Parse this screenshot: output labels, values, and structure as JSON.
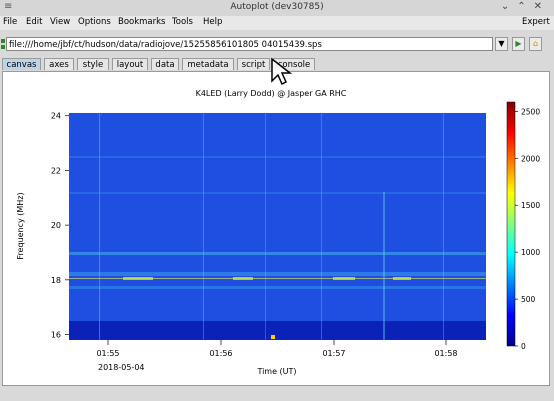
{
  "window": {
    "title": "Autoplot (dev30785)"
  },
  "menu": {
    "file": "File",
    "edit": "Edit",
    "view": "View",
    "options": "Options",
    "bookmarks": "Bookmarks",
    "tools": "Tools",
    "help": "Help",
    "expert": "Expert"
  },
  "url": {
    "value": "file:///home/jbf/ct/hudson/data/radiojove/15255856101805 04015439.sps"
  },
  "tabs": [
    "canvas",
    "axes",
    "style",
    "layout",
    "data",
    "metadata",
    "script",
    "console"
  ],
  "chart_data": {
    "type": "heatmap",
    "title": "K4LED (Larry Dodd) @ Jasper GA RHC",
    "xlabel": "Time (UT)",
    "ylabel": "Frequency (MHz)",
    "x_ticks": [
      "01:55",
      "01:56",
      "01:57",
      "01:58"
    ],
    "x_date_label": "2018-05-04",
    "y_ticks": [
      16,
      18,
      20,
      22,
      24
    ],
    "ylim": [
      15.8,
      24.1
    ],
    "colorbar": {
      "min": 0,
      "max": 2600,
      "ticks": [
        0,
        500,
        1000,
        1500,
        2000,
        2500
      ]
    },
    "notes": "Predominantly blue spectrogram with faint horizontal lines near 18 and 17 MHz and vertical bursts."
  }
}
